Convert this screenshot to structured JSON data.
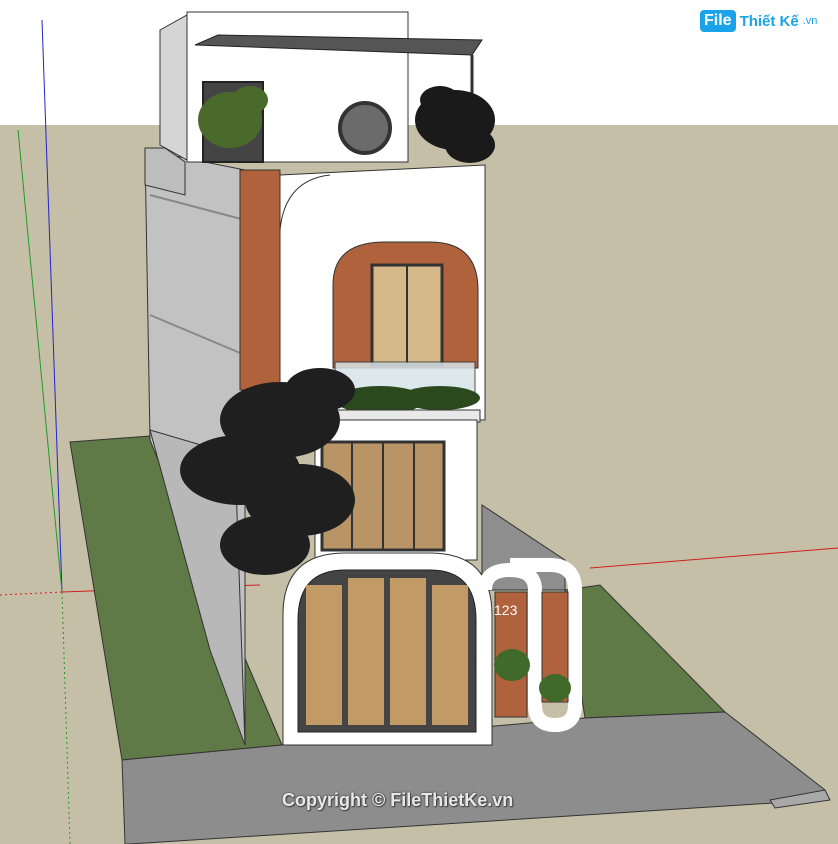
{
  "logo": {
    "brand_box": "File",
    "brand_text": "Thiết Kế",
    "brand_suffix": ".vn"
  },
  "watermark": "Copyright © FileThietKe.vn",
  "house_number": "123",
  "colors": {
    "sky": "#ffffff",
    "ground_plane": "#c4bfa6",
    "lawn": "#5f7a47",
    "road": "#8d8d8d",
    "wall_white": "#ffffff",
    "wall_grey": "#bfbfbf",
    "brick": "#b0623d",
    "axis_red": "#d21f1f",
    "axis_green": "#1f9a28",
    "axis_blue": "#2424c8",
    "logo_blue": "#1aa3e8"
  }
}
